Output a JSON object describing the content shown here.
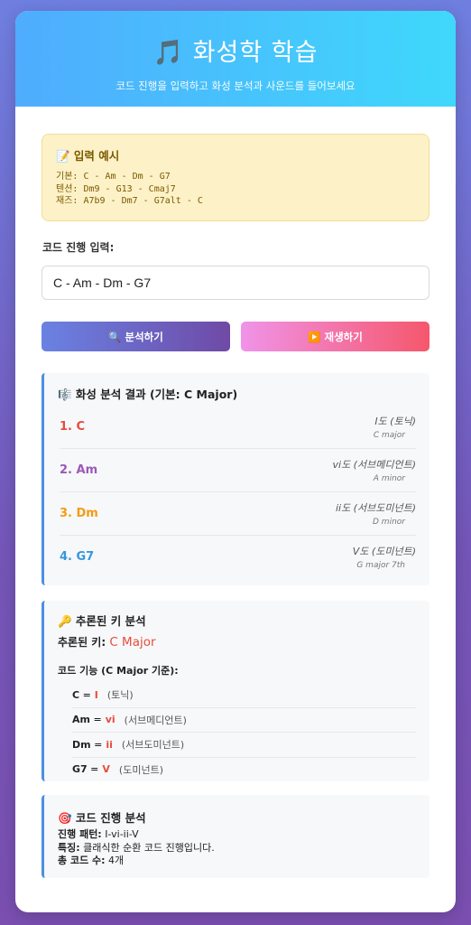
{
  "header": {
    "title": "🎵 화성학 학습",
    "subtitle": "코드 진행을 입력하고 화성 분석과 사운드를 들어보세요"
  },
  "example": {
    "title": "📝 입력 예시",
    "lines": [
      "기본: C - Am - Dm - G7",
      "텐션: Dm9 - G13 - Cmaj7",
      "재즈: A7b9 - Dm7 - G7alt - C"
    ]
  },
  "input": {
    "label": "코드 진행 입력:",
    "value": "C - Am - Dm - G7"
  },
  "buttons": {
    "analyze": "🔍 분석하기",
    "play": "▶️ 재생하기"
  },
  "analysis": {
    "title": "🎼 화성 분석 결과 (기본: C Major)",
    "chords": [
      {
        "name": "1. C",
        "degree": "I도 (토닉)",
        "quality": "C major",
        "color": "#e74c3c"
      },
      {
        "name": "2. Am",
        "degree": "vi도 (서브메디언트)",
        "quality": "A minor",
        "color": "#9b59b6"
      },
      {
        "name": "3. Dm",
        "degree": "ii도 (서브도미넌트)",
        "quality": "D minor",
        "color": "#f39c12"
      },
      {
        "name": "4. G7",
        "degree": "V도 (도미넌트)",
        "quality": "G major 7th",
        "color": "#3498db"
      }
    ]
  },
  "key": {
    "title": "🔑 추론된 키 분석",
    "label": "추론된 키:",
    "value": "C Major",
    "func_title": "코드 기능 (C Major 기준):",
    "functions": [
      {
        "chord": "C",
        "roman": "I",
        "fn": "(토닉)"
      },
      {
        "chord": "Am",
        "roman": "vi",
        "fn": "(서브메디언트)"
      },
      {
        "chord": "Dm",
        "roman": "ii",
        "fn": "(서브도미넌트)"
      },
      {
        "chord": "G7",
        "roman": "V",
        "fn": "(도미넌트)"
      }
    ]
  },
  "progression": {
    "title": "🎯 코드 진행 분석",
    "pattern_label": "진행 패턴:",
    "pattern": "I-vi-ii-V",
    "feature_label": "특징:",
    "feature": "클래식한 순환 코드 진행입니다.",
    "count_label": "총 코드 수:",
    "count": "4개"
  },
  "colors": {
    "accent_red": "#e74c3c",
    "section_border": "#4a90e2"
  }
}
